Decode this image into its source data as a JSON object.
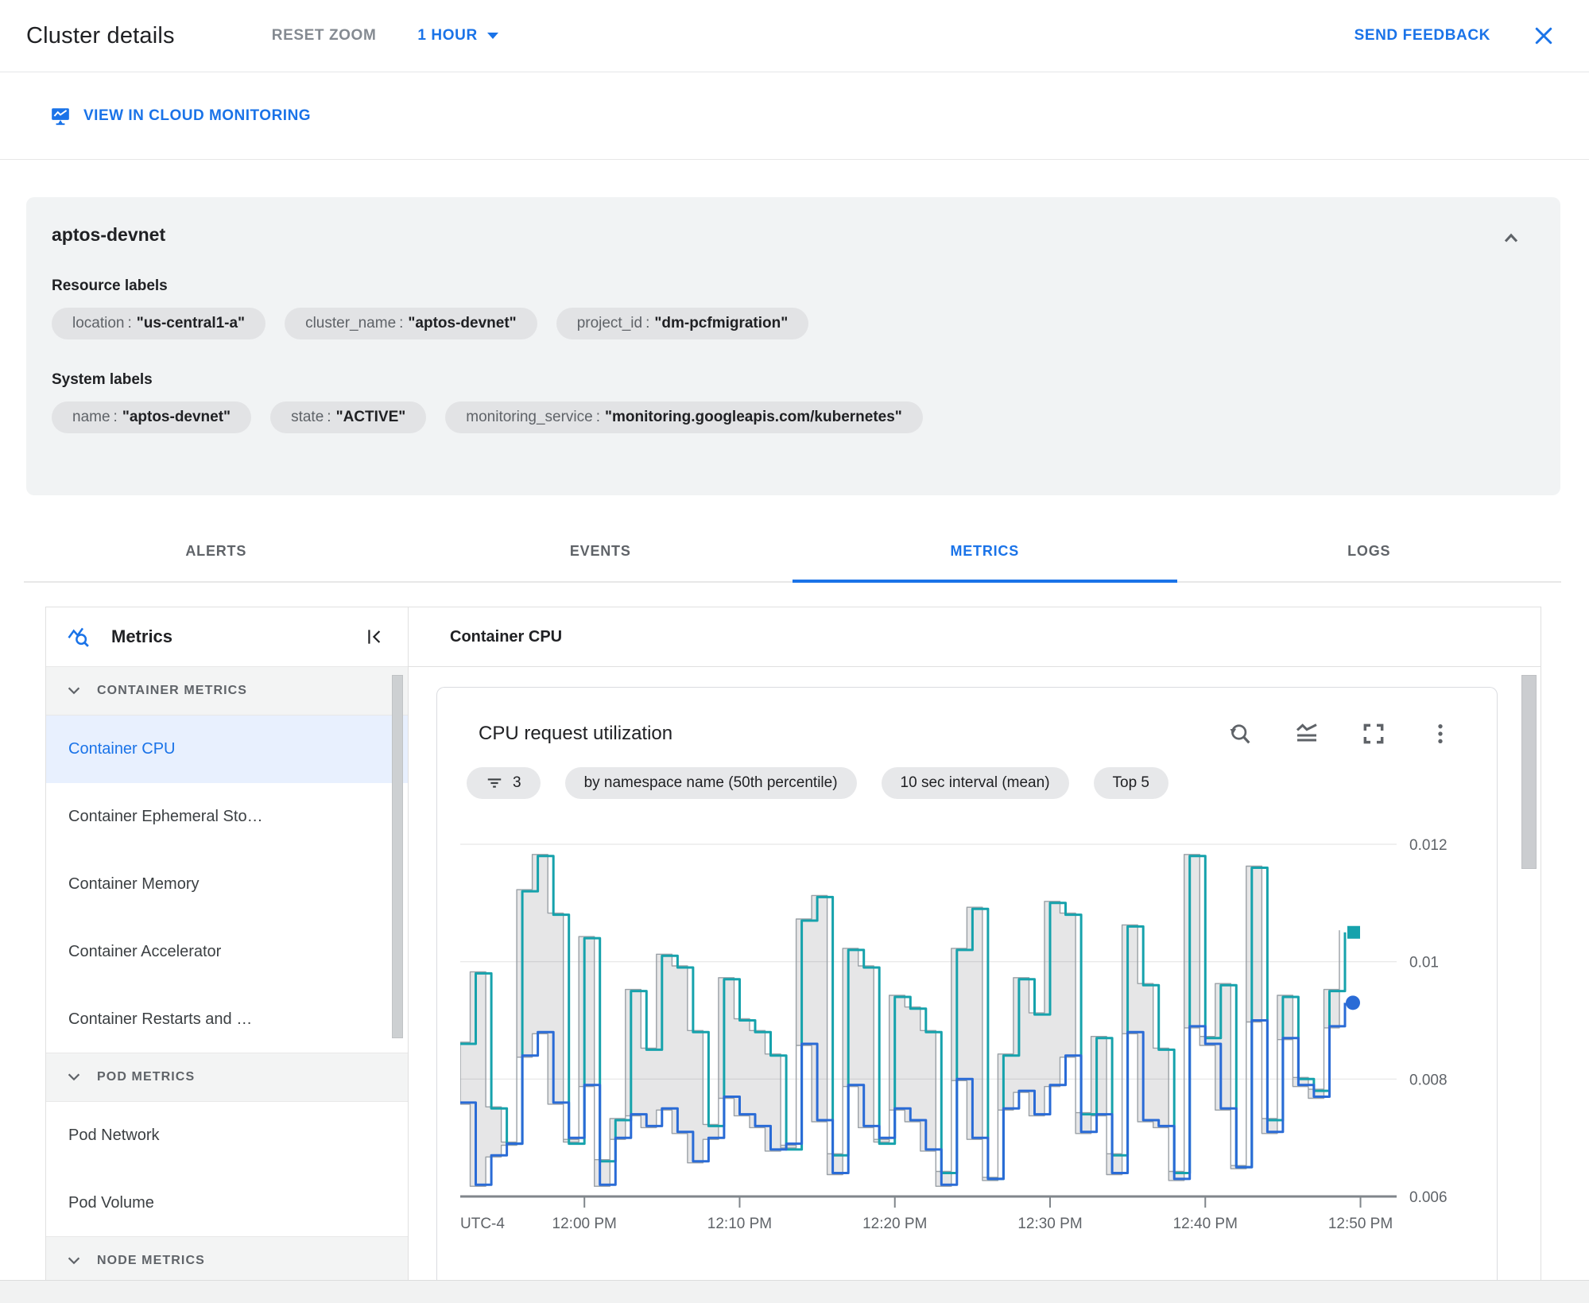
{
  "header": {
    "title": "Cluster details",
    "reset_zoom": "RESET ZOOM",
    "time_range": "1 HOUR",
    "send_feedback": "SEND FEEDBACK"
  },
  "actionbar": {
    "view_in_monitoring": "VIEW IN CLOUD MONITORING"
  },
  "info": {
    "title": "aptos-devnet",
    "resource_labels": {
      "heading": "Resource labels",
      "chips": [
        {
          "key": "location",
          "value": "\"us-central1-a\""
        },
        {
          "key": "cluster_name",
          "value": "\"aptos-devnet\""
        },
        {
          "key": "project_id",
          "value": "\"dm-pcfmigration\""
        }
      ]
    },
    "system_labels": {
      "heading": "System labels",
      "chips": [
        {
          "key": "name",
          "value": "\"aptos-devnet\""
        },
        {
          "key": "state",
          "value": "\"ACTIVE\""
        },
        {
          "key": "monitoring_service",
          "value": "\"monitoring.googleapis.com/kubernetes\""
        }
      ]
    }
  },
  "tabs": [
    {
      "label": "ALERTS"
    },
    {
      "label": "EVENTS"
    },
    {
      "label": "METRICS"
    },
    {
      "label": "LOGS"
    }
  ],
  "sidebar": {
    "title": "Metrics",
    "sections": [
      {
        "title": "CONTAINER METRICS"
      },
      {
        "title": "POD METRICS"
      },
      {
        "title": "NODE METRICS"
      }
    ],
    "container_items": [
      {
        "label": "Container CPU"
      },
      {
        "label": "Container Ephemeral Sto…"
      },
      {
        "label": "Container Memory"
      },
      {
        "label": "Container Accelerator"
      },
      {
        "label": "Container Restarts and …"
      }
    ],
    "pod_items": [
      {
        "label": "Pod Network"
      },
      {
        "label": "Pod Volume"
      }
    ]
  },
  "main": {
    "header": "Container CPU"
  },
  "chart_data": {
    "type": "line",
    "title": "CPU request utilization",
    "filter_chips": {
      "filter_count": "3",
      "group_by": "by namespace name (50th percentile)",
      "interval": "10 sec interval (mean)",
      "top": "Top 5"
    },
    "legend": "hidden",
    "grid": true,
    "y_axis": {
      "min": 0.006,
      "max": 0.012,
      "ticks": [
        0.012,
        0.01,
        0.008,
        0.006
      ],
      "tick_labels": [
        "0.012",
        "0.01",
        "0.008",
        "0.006"
      ]
    },
    "x_axis": {
      "prefix_label": "UTC-4",
      "start": "11:52 AM",
      "minutes_per_point": 1,
      "ticks": [
        {
          "m": 8,
          "label": "12:00 PM"
        },
        {
          "m": 18,
          "label": "12:10 PM"
        },
        {
          "m": 28,
          "label": "12:20 PM"
        },
        {
          "m": 38,
          "label": "12:30 PM"
        },
        {
          "m": 48,
          "label": "12:40 PM"
        },
        {
          "m": 58,
          "label": "12:50 PM"
        }
      ]
    },
    "series": [
      {
        "name": "namespace-series-teal",
        "color": "#16a2ac",
        "marker": "square",
        "values": [
          0.0086,
          0.0098,
          0.0075,
          0.0069,
          0.0112,
          0.0118,
          0.0108,
          0.0069,
          0.0104,
          0.0066,
          0.0073,
          0.0095,
          0.0085,
          0.0101,
          0.0099,
          0.0088,
          0.0072,
          0.0097,
          0.009,
          0.0088,
          0.0084,
          0.0068,
          0.0107,
          0.0111,
          0.0067,
          0.0102,
          0.0099,
          0.0069,
          0.0094,
          0.0092,
          0.0088,
          0.0064,
          0.0102,
          0.0109,
          0.0063,
          0.0084,
          0.0097,
          0.0091,
          0.011,
          0.0108,
          0.0074,
          0.0087,
          0.0067,
          0.0106,
          0.0096,
          0.0085,
          0.0064,
          0.0118,
          0.0087,
          0.0096,
          0.0065,
          0.0116,
          0.0073,
          0.0094,
          0.008,
          0.0078,
          0.0095,
          0.0105
        ]
      },
      {
        "name": "namespace-series-blue",
        "color": "#2a6bd6",
        "marker": "circle",
        "values": [
          0.0076,
          0.0062,
          0.0067,
          0.0069,
          0.0084,
          0.0088,
          0.0076,
          0.007,
          0.0079,
          0.0062,
          0.007,
          0.0074,
          0.0072,
          0.0075,
          0.0071,
          0.0066,
          0.007,
          0.0077,
          0.0074,
          0.0072,
          0.0068,
          0.0069,
          0.0086,
          0.0073,
          0.0064,
          0.0079,
          0.0072,
          0.007,
          0.0075,
          0.0073,
          0.0068,
          0.0062,
          0.008,
          0.007,
          0.0063,
          0.0075,
          0.0078,
          0.0074,
          0.0079,
          0.0084,
          0.0071,
          0.0074,
          0.0064,
          0.0088,
          0.0073,
          0.0072,
          0.0063,
          0.0089,
          0.0086,
          0.0075,
          0.0065,
          0.009,
          0.0071,
          0.0087,
          0.0079,
          0.0077,
          0.0089,
          0.0093
        ]
      },
      {
        "name": "namespace-band-gray",
        "color": "#9aa0a6",
        "fill": "rgba(60,64,67,0.13)",
        "between": [
          "namespace-series-teal",
          "namespace-series-blue"
        ]
      }
    ]
  },
  "colors": {
    "accent_blue": "#1a73e8",
    "teal_line": "#16a2ac",
    "blue_line": "#2a6bd6",
    "band_stroke": "#9aa0a6",
    "grid_line": "#e6e6e6",
    "axis_line": "#80868b",
    "selected_row_bg": "#e8f0fe",
    "panel_bg": "#f1f3f4"
  }
}
